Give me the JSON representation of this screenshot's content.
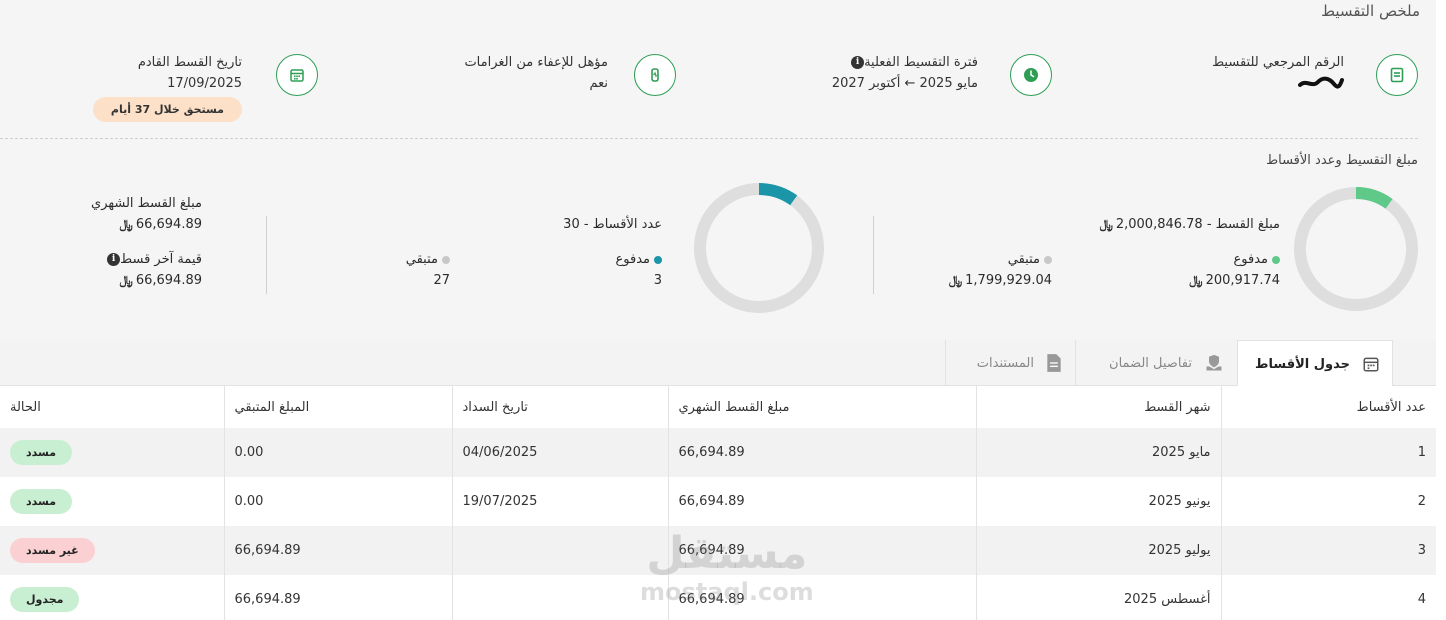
{
  "summary": {
    "title": "ملخص التقسيط",
    "reference": {
      "label": "الرقم المرجعي للتقسيط"
    },
    "period": {
      "label": "فترة التقسيط الفعلية",
      "from": "مايو 2025",
      "to": "أكتوبر 2027",
      "arrow": "←"
    },
    "penalty": {
      "label": "مؤهل للإعفاء من الغرامات",
      "value": "نعم"
    },
    "next": {
      "label": "تاريخ القسط القادم",
      "value": "17/09/2025",
      "badge": "مستحق خلال 37 أيام"
    }
  },
  "amounts": {
    "title": "مبلغ التقسيط وعدد الأقساط",
    "amount_chart": {
      "label": "مبلغ القسط - 2,000,846.78",
      "paid_label": "مدفوع",
      "paid_value": "200,917.74",
      "remaining_label": "متبقي",
      "remaining_value": "1,799,929.04",
      "paid_fraction": 0.1004,
      "color": "#5fc98a"
    },
    "count_chart": {
      "label": "عدد الأقساط - 30",
      "paid_label": "مدفوع",
      "paid_value": "3",
      "remaining_label": "متبقي",
      "remaining_value": "27",
      "paid_fraction": 0.1,
      "color": "#1b95a8"
    },
    "monthly": {
      "label": "مبلغ القسط الشهري",
      "value": "66,694.89"
    },
    "last": {
      "label": "قيمة آخر قسط",
      "value": "66,694.89"
    },
    "currency_symbol": "﷼"
  },
  "tabs": [
    {
      "label": "جدول الأقساط",
      "icon": "calendar-icon",
      "active": true
    },
    {
      "label": "تفاصيل الضمان",
      "icon": "shield-hand-icon",
      "active": false
    },
    {
      "label": "المستندات",
      "icon": "document-icon",
      "active": false
    }
  ],
  "table": {
    "headers": [
      "عدد الأقساط",
      "شهر القسط",
      "مبلغ القسط الشهري",
      "تاريخ السداد",
      "المبلغ المتبقي",
      "الحالة"
    ],
    "rows": [
      {
        "n": "1",
        "month": "مايو 2025",
        "amount": "66,694.89",
        "date": "04/06/2025",
        "remaining": "0.00",
        "status": "مسدد",
        "status_color": "#c9efd2"
      },
      {
        "n": "2",
        "month": "يونيو 2025",
        "amount": "66,694.89",
        "date": "19/07/2025",
        "remaining": "0.00",
        "status": "مسدد",
        "status_color": "#c9efd2"
      },
      {
        "n": "3",
        "month": "يوليو 2025",
        "amount": "66,694.89",
        "date": "",
        "remaining": "66,694.89",
        "status": "غير مسدد",
        "status_color": "#fbd0d3"
      },
      {
        "n": "4",
        "month": "أغسطس 2025",
        "amount": "66,694.89",
        "date": "",
        "remaining": "66,694.89",
        "status": "مجدول",
        "status_color": "#c9efd2"
      }
    ]
  },
  "watermark": {
    "ar": "مستقل",
    "en": "mostaql.com"
  },
  "colors": {
    "accent": "#2e9e55",
    "muted": "#dedede"
  }
}
